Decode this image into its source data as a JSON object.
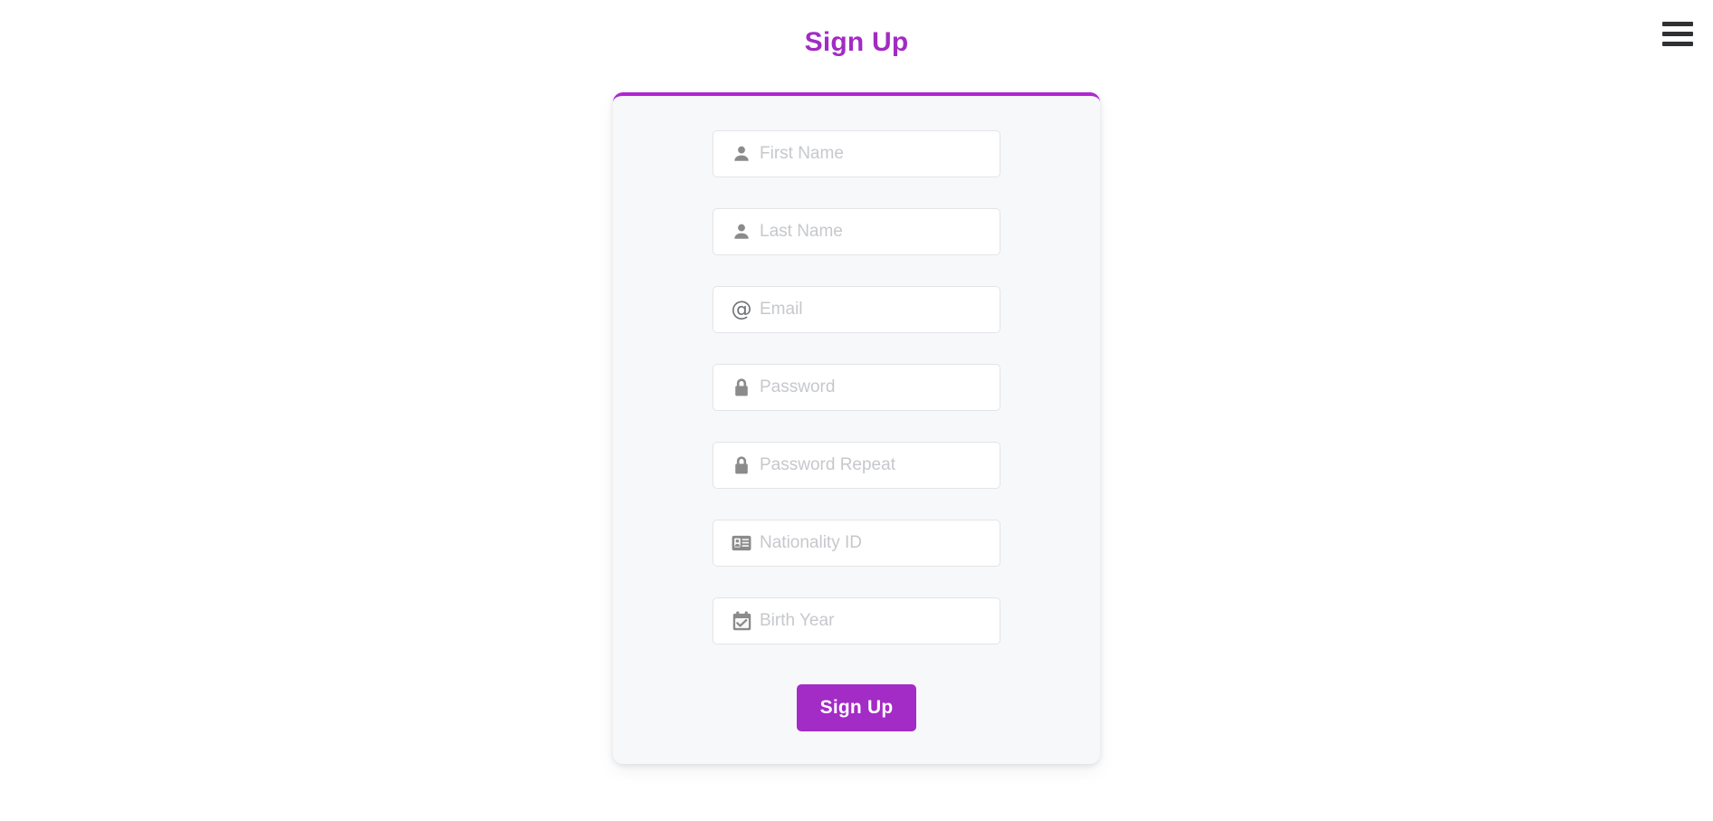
{
  "header": {
    "title": "Sign Up",
    "menu_icon": "hamburger-menu-icon"
  },
  "theme": {
    "accent": "#a22bc4",
    "card_top_border": "#b026d3",
    "button_bg": "#a32bc6",
    "page_bg": "#ffffff",
    "card_bg": "#f7f8fa",
    "placeholder": "#c6c8cc",
    "icon": "#8b8b8b"
  },
  "form": {
    "fields": [
      {
        "name": "first-name",
        "placeholder": "First Name",
        "value": "",
        "type": "text",
        "icon": "user-icon"
      },
      {
        "name": "last-name",
        "placeholder": "Last Name",
        "value": "",
        "type": "text",
        "icon": "user-icon"
      },
      {
        "name": "email",
        "placeholder": "Email",
        "value": "",
        "type": "email",
        "icon": "at-sign-icon"
      },
      {
        "name": "password",
        "placeholder": "Password",
        "value": "",
        "type": "password",
        "icon": "lock-icon"
      },
      {
        "name": "password-repeat",
        "placeholder": "Password Repeat",
        "value": "",
        "type": "password",
        "icon": "lock-icon"
      },
      {
        "name": "nationality-id",
        "placeholder": "Nationality ID",
        "value": "",
        "type": "text",
        "icon": "id-card-icon"
      },
      {
        "name": "birth-year",
        "placeholder": "Birth Year",
        "value": "",
        "type": "text",
        "icon": "calendar-check-icon"
      }
    ],
    "submit_label": "Sign Up"
  }
}
